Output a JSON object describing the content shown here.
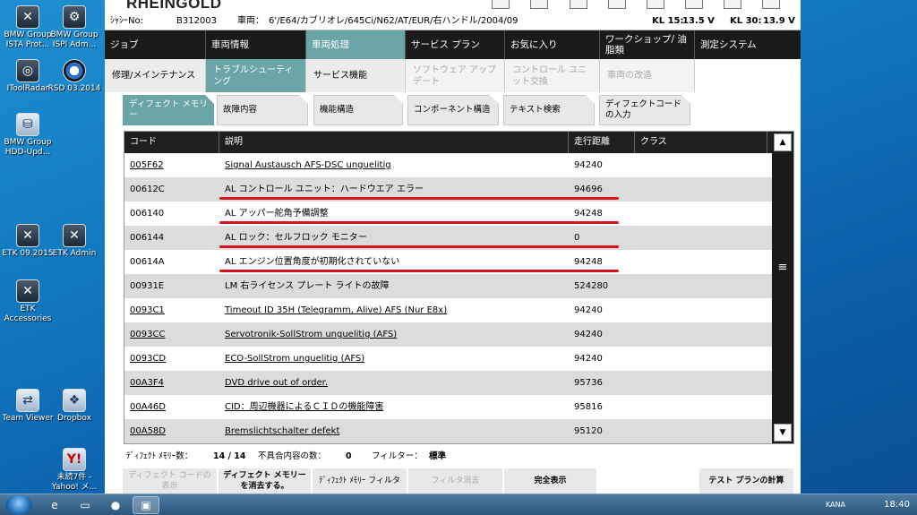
{
  "desktop_icons": [
    {
      "label": "BMW Group ISTA Prot...",
      "glyph": "wrench-screen-icon"
    },
    {
      "label": "BMW Group ISPI Adm...",
      "glyph": "gear-screen-icon"
    },
    {
      "label": "IToolRadar",
      "glyph": "radar-icon"
    },
    {
      "label": "RSD 03.2014",
      "glyph": "bmw-logo-icon"
    },
    {
      "label": "BMW Group HDD-Upd...",
      "glyph": "disk-icon"
    },
    {
      "label": "ETK 09.2015",
      "glyph": "etk-icon"
    },
    {
      "label": "ETK Admin",
      "glyph": "etk-admin-icon"
    },
    {
      "label": "ETK Accessories",
      "glyph": "etk-accessories-icon"
    },
    {
      "label": "Team Viewer",
      "glyph": "teamviewer-icon"
    },
    {
      "label": "Dropbox",
      "glyph": "dropbox-icon"
    },
    {
      "label": "未読7件 - Yahoo! メ...",
      "glyph": "yahoo-mail-icon"
    }
  ],
  "app": {
    "name": "RHEINGOLD",
    "info": {
      "vin_label": "ｼｬｼｰNo:",
      "vin": "B312003",
      "vehicle_label": "車両：",
      "vehicle": "6'/E64/カブリオレ/645Ci/N62/AT/EUR/右ハンドル/2004/09",
      "kl15_label": "KL 15:",
      "kl15": "13.5 V",
      "kl30_label": "KL 30:",
      "kl30": "13.9 V"
    },
    "nav1": [
      "ジョブ",
      "車両情報",
      "車両処理",
      "サービス プラン",
      "お気に入り",
      "ワークショップ/ 油脂類",
      "測定システム"
    ],
    "nav2": [
      "修理/メインテナンス",
      "トラブルシューティング",
      "サービス機能",
      "ソフトウェア アップデート",
      "コントロール ユニット交換",
      "車両の改造"
    ],
    "tabs": [
      "ディフェクト メモリー",
      "故障内容",
      "機能構造",
      "コンポーネント構造",
      "テキスト検索",
      "ディフェクトコードの入力"
    ],
    "table": {
      "headers": {
        "code": "コード",
        "desc": "説明",
        "km": "走行距離",
        "class": "クラス"
      },
      "rows": [
        {
          "code": "005F62",
          "desc": "Signal Austausch AFS-DSC unguelitig",
          "km": "94240"
        },
        {
          "code": "00612C",
          "desc": "AL コントロール ユニット：ハードウエア エラー",
          "km": "94696"
        },
        {
          "code": "006140",
          "desc": "AL アッパー舵角予備調整",
          "km": "94248"
        },
        {
          "code": "006144",
          "desc": "AL ロック：セルフロック モニター",
          "km": "0"
        },
        {
          "code": "00614A",
          "desc": "AL エンジン位置角度が初期化されていない",
          "km": "94248"
        },
        {
          "code": "00931E",
          "desc": "LM 右ライセンス プレート ライトの故障",
          "km": "524280"
        },
        {
          "code": "0093C1",
          "desc": "Timeout ID 35H (Telegramm, Alive) AFS (Nur E8x)",
          "km": "94240"
        },
        {
          "code": "0093CC",
          "desc": "Servotronik-SollStrom unguelitig (AFS)",
          "km": "94240"
        },
        {
          "code": "0093CD",
          "desc": "ECO-SollStrom unguelitig (AFS)",
          "km": "94240"
        },
        {
          "code": "00A3F4",
          "desc": "DVD drive out of order.",
          "km": "95736"
        },
        {
          "code": "00A46D",
          "desc": "CID：周辺機器によるＣＩＤの機能障害",
          "km": "95816"
        },
        {
          "code": "00A58D",
          "desc": "Bremslichtschalter defekt",
          "km": "95120"
        }
      ]
    },
    "status": {
      "mem_label": "ﾃﾞｨﾌｪｸﾄ ﾒﾓﾘｰ数：",
      "mem_value": "14 / 14",
      "fault_label": "不具合内容の数：",
      "fault_value": "0",
      "filter_label": "フィルター：",
      "filter_value": "標準"
    },
    "footer_buttons": [
      "ディフェクト コードの表示",
      "ディフェクト メモリーを消去する。",
      "ﾃﾞｨﾌｪｸﾄ ﾒﾓﾘｰ フィルタ",
      "フィルタ消去",
      "完全表示",
      "テスト プランの計算"
    ]
  },
  "taskbar": {
    "clock": "18:40",
    "ime": "KANA"
  },
  "colors": {
    "accent": "#6aa5a8",
    "highlight_underline": "#d4141b"
  }
}
